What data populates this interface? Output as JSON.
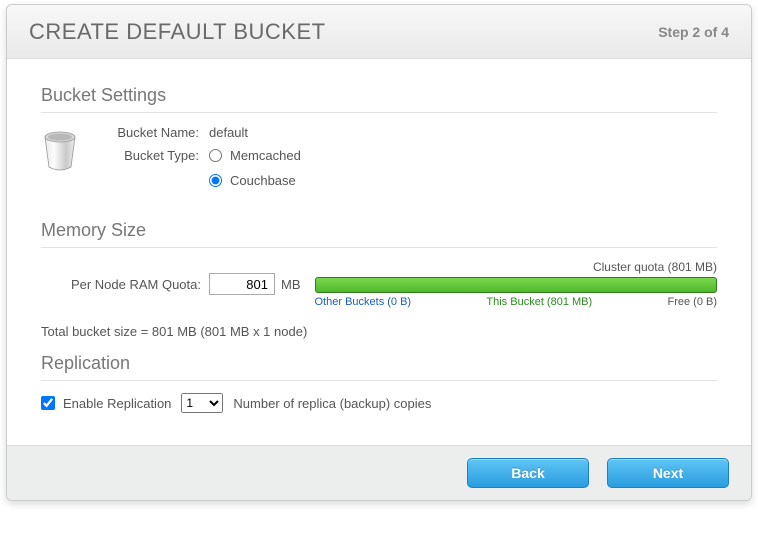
{
  "header": {
    "title": "CREATE DEFAULT BUCKET",
    "step": "Step 2 of 4"
  },
  "sections": {
    "bucket_settings": {
      "title": "Bucket Settings",
      "name_label": "Bucket Name:",
      "name_value": "default",
      "type_label": "Bucket Type:",
      "type_options": {
        "memcached": "Memcached",
        "couchbase": "Couchbase"
      },
      "type_selected": "couchbase"
    },
    "memory": {
      "title": "Memory Size",
      "per_node_label": "Per Node RAM Quota:",
      "per_node_value": "801",
      "unit": "MB",
      "cluster_quota_label": "Cluster quota (801 MB)",
      "legend": {
        "other": "Other Buckets (0 B)",
        "this": "This Bucket (801 MB)",
        "free": "Free (0 B)"
      },
      "total_label": "Total bucket size = 801 MB (801 MB x 1 node)"
    },
    "replication": {
      "title": "Replication",
      "enable_label": "Enable Replication",
      "enabled": true,
      "replica_value": "1",
      "copies_label": "Number of replica (backup) copies"
    }
  },
  "footer": {
    "back": "Back",
    "next": "Next"
  }
}
